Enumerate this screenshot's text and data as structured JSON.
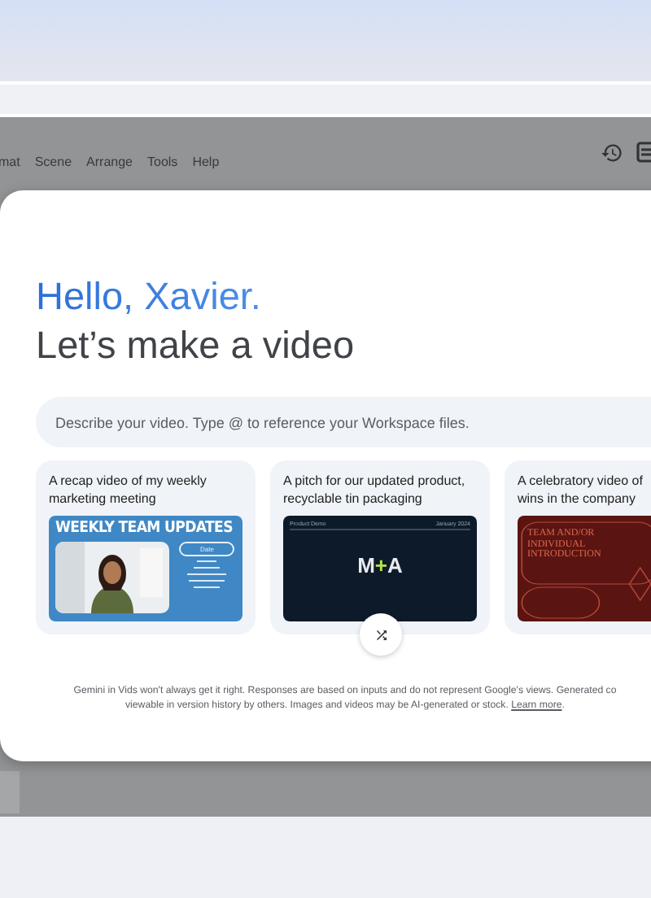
{
  "menu": [
    "mat",
    "Scene",
    "Arrange",
    "Tools",
    "Help"
  ],
  "dialog": {
    "greeting": "Hello, Xavier.",
    "headline": "Let’s make a video",
    "prompt": {
      "placeholder": "Describe your video. Type @ to reference your Workspace files."
    },
    "suggestions": [
      {
        "title": [
          "A recap video of my weekly",
          "marketing meeting"
        ],
        "thumbnail": {
          "kind": "team-updates",
          "heading": "WEEKLY TEAM UPDATES",
          "pill": "Date"
        }
      },
      {
        "title": [
          "A pitch for our updated product,",
          "recyclable tin packaging"
        ],
        "thumbnail": {
          "kind": "product",
          "left": "Product Demo",
          "right": "January 2024",
          "logo_a": "M",
          "logo_plus": "+",
          "logo_b": "A"
        }
      },
      {
        "title": [
          "A celebratory video of",
          "wins in the company"
        ],
        "thumbnail": {
          "kind": "intro",
          "heading": "TEAM AND/OR INDIVIDUAL INTRODUCTION"
        }
      }
    ],
    "disclaimer": {
      "line_1": "Gemini in Vids won't always get it right. Responses are based on inputs and do not represent Google's views. Generated co",
      "line_2": "viewable in version history by others. Images and videos may be AI-generated or stock.",
      "link": "Learn more",
      "after_link": "."
    }
  }
}
